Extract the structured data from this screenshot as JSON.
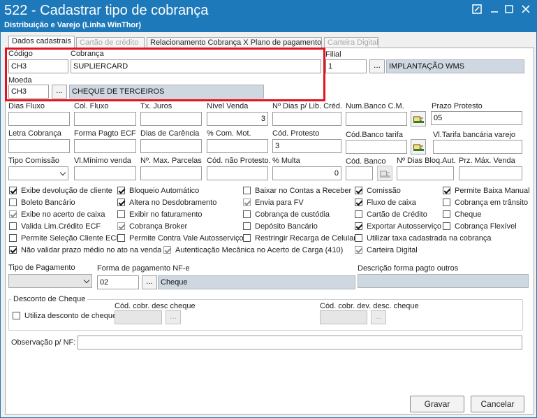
{
  "window": {
    "title": "522 - Cadastrar tipo de cobrança",
    "subtitle": "Distribuição e Varejo (Linha WinThor)"
  },
  "tabs": [
    {
      "label": "Dados cadastrais"
    },
    {
      "label": "Cartão de crédito"
    },
    {
      "label": "Relacionamento Cobrança X Plano de pagamento"
    },
    {
      "label": "Carteira Digital"
    }
  ],
  "fields": {
    "codigo": {
      "label": "Código",
      "value": "CH3"
    },
    "cobranca": {
      "label": "Cobrança",
      "value": "SUPLIERCARD"
    },
    "filial": {
      "label": "Filial",
      "value": "1",
      "desc": "IMPLANTAÇÃO WMS"
    },
    "moeda": {
      "label": "Moeda",
      "value": "CH3",
      "desc": "CHEQUE DE TERCEIROS"
    },
    "dias_fluxo": {
      "label": "Dias Fluxo",
      "value": ""
    },
    "col_fluxo": {
      "label": "Col. Fluxo",
      "value": ""
    },
    "tx_juros": {
      "label": "Tx. Juros",
      "value": ""
    },
    "nivel_venda": {
      "label": "Nível Venda",
      "value": "3"
    },
    "dias_lib_cred": {
      "label": "Nº Dias p/ Lib. Créd.",
      "value": ""
    },
    "num_banco_cm": {
      "label": "Num.Banco C.M.",
      "value": ""
    },
    "prazo_protesto": {
      "label": "Prazo Protesto",
      "value": "05"
    },
    "letra_cobranca": {
      "label": "Letra Cobrança",
      "value": ""
    },
    "forma_pagto_ecf": {
      "label": "Forma Pagto ECF",
      "value": ""
    },
    "dias_carencia": {
      "label": "Dias de Carência",
      "value": ""
    },
    "com_mot": {
      "label": "% Com. Mot.",
      "value": ""
    },
    "cod_protesto": {
      "label": "Cód. Protesto",
      "value": "3"
    },
    "cod_banco_tarifa": {
      "label": "Cód.Banco tarifa",
      "value": ""
    },
    "vl_tarifa": {
      "label": "Vl.Tarifa bancária varejo",
      "value": ""
    },
    "tipo_comissao": {
      "label": "Tipo Comissão",
      "value": ""
    },
    "vl_minimo_venda": {
      "label": "Vl.Mínimo venda",
      "value": ""
    },
    "max_parcelas": {
      "label": "Nº. Max. Parcelas",
      "value": ""
    },
    "cod_nao_protesto": {
      "label": "Cód. não Protesto.",
      "value": ""
    },
    "multa": {
      "label": "% Multa",
      "value": "0"
    },
    "cod_banco": {
      "label": "Cód. Banco",
      "value": ""
    },
    "dias_bloq_aut": {
      "label": "Nº Dias Bloq.Aut.",
      "value": ""
    },
    "prz_max_venda": {
      "label": "Prz. Máx. Venda",
      "value": ""
    }
  },
  "checkboxes": [
    {
      "label": "Exibe devolução de cliente",
      "checked": true,
      "enabled": true
    },
    {
      "label": "Boleto Bancário",
      "checked": false,
      "enabled": true
    },
    {
      "label": "Exibe no acerto de caixa",
      "checked": true,
      "enabled": false
    },
    {
      "label": "Valida Lim.Crédito ECF",
      "checked": false,
      "enabled": true
    },
    {
      "label": "Permite Seleção Cliente ECF",
      "checked": false,
      "enabled": true
    },
    {
      "label": "Não validar prazo médio no ato na venda",
      "checked": true,
      "enabled": true
    },
    {
      "label": "Bloqueio Automático",
      "checked": true,
      "enabled": true
    },
    {
      "label": "Altera no Desdobramento",
      "checked": true,
      "enabled": true
    },
    {
      "label": "Exibir no faturamento",
      "checked": false,
      "enabled": true
    },
    {
      "label": "Cobrança Broker",
      "checked": true,
      "enabled": false
    },
    {
      "label": "Permite Contra Vale Autosserviço",
      "checked": false,
      "enabled": true
    },
    {
      "label": "Autenticação Mecânica no Acerto de Carga (410)",
      "checked": true,
      "enabled": false
    },
    {
      "label": "Baixar no Contas a Receber",
      "checked": false,
      "enabled": true
    },
    {
      "label": "Envia para FV",
      "checked": true,
      "enabled": false
    },
    {
      "label": "Cobrança de custódia",
      "checked": false,
      "enabled": true
    },
    {
      "label": "Depósito Bancário",
      "checked": false,
      "enabled": true
    },
    {
      "label": "Restringir Recarga de Celular",
      "checked": false,
      "enabled": true
    },
    {
      "label": "Comissão",
      "checked": true,
      "enabled": true
    },
    {
      "label": "Fluxo de caixa",
      "checked": true,
      "enabled": true
    },
    {
      "label": "Cartão de Crédito",
      "checked": false,
      "enabled": true
    },
    {
      "label": "Exportar Autosserviço",
      "checked": true,
      "enabled": true
    },
    {
      "label": "Utilizar taxa cadastrada na cobrança",
      "checked": false,
      "enabled": true
    },
    {
      "label": "Carteira Digital",
      "checked": true,
      "enabled": false
    },
    {
      "label": "Permite Baixa Manual",
      "checked": true,
      "enabled": true
    },
    {
      "label": "Cobrança em trânsito",
      "checked": false,
      "enabled": true
    },
    {
      "label": "Cheque",
      "checked": false,
      "enabled": true
    },
    {
      "label": "Cobrança Flexível",
      "checked": false,
      "enabled": true
    }
  ],
  "pagamento": {
    "tipo_label": "Tipo de Pagamento",
    "tipo_value": "",
    "forma_nfe_label": "Forma de pagamento NF-e",
    "forma_nfe_code": "02",
    "forma_nfe_desc": "Cheque",
    "desc_outros_label": "Descrição forma pagto outros",
    "desc_outros_value": ""
  },
  "desconto_cheque": {
    "group_title": "Desconto de Cheque",
    "utiliza_label": "Utiliza desconto de cheque",
    "utiliza_checked": false,
    "cod_desc_label": "Cód. cobr. desc cheque",
    "cod_desc_value": "",
    "cod_dev_label": "Cód. cobr. dev. desc. cheque",
    "cod_dev_value": ""
  },
  "observacao": {
    "label": "Observação p/ NF:",
    "value": ""
  },
  "buttons": {
    "ellipsis": "...",
    "gravar": "Gravar",
    "cancelar": "Cancelar"
  }
}
